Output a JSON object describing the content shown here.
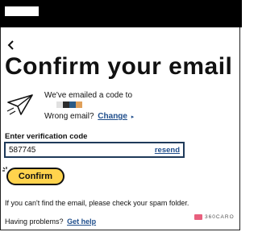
{
  "header": {
    "redacted_box": ""
  },
  "page": {
    "title": "Confirm your email",
    "emailed_text": "We've emailed a code to",
    "email_redaction_colors": [
      "#e1e1e1",
      "#2b2b2b",
      "#2a5a86",
      "#e0a05a"
    ],
    "wrong_email_text": "Wrong email?",
    "change_link": "Change",
    "change_caret": "▸",
    "code_label": "Enter verification code",
    "code_value": "587745",
    "resend_link": "resend",
    "confirm_button": "Confirm",
    "spam_info": "If you can't find the email, please check your spam folder.",
    "problems_text": "Having problems?",
    "help_link": "Get help"
  },
  "watermark": {
    "text": "360CARO"
  },
  "colors": {
    "accent": "#1f4e8c",
    "button": "#ffd34d",
    "topbar": "#000000"
  },
  "icons": [
    "back-arrow-icon",
    "paper-plane-icon",
    "sparkle-icon"
  ]
}
